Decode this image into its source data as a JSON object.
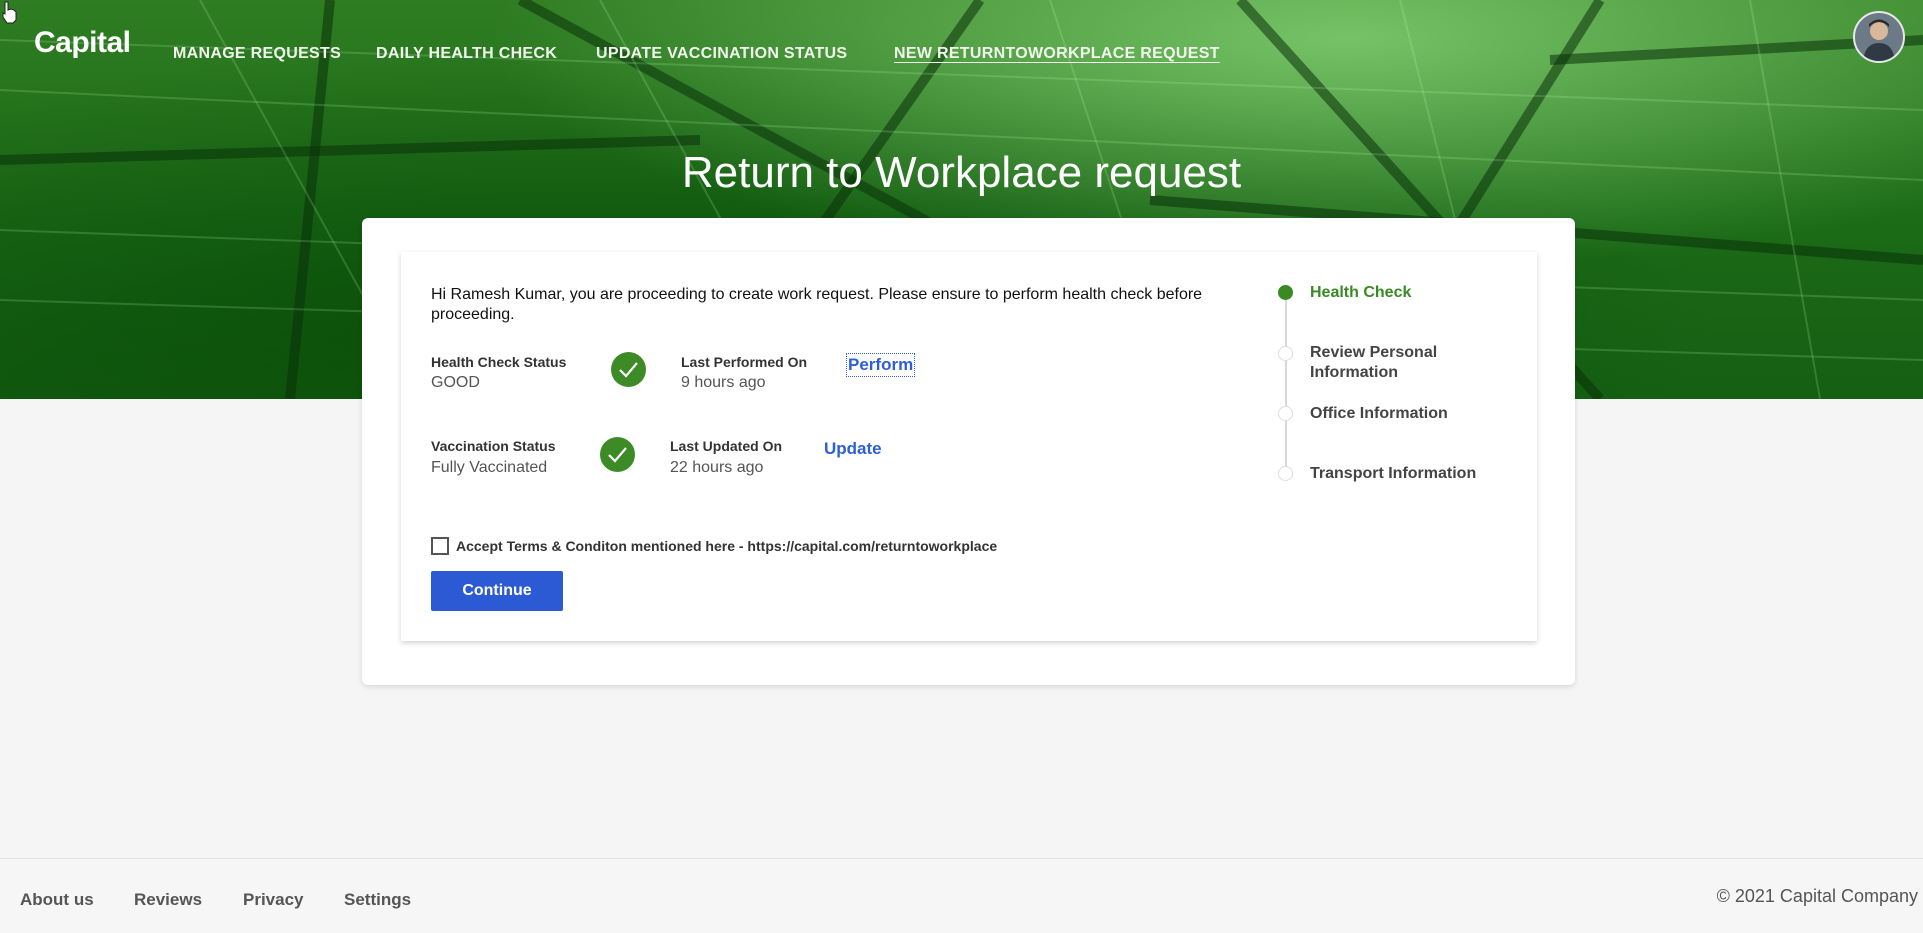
{
  "header": {
    "logo": "Capital",
    "nav": [
      {
        "label": "MANAGE REQUESTS"
      },
      {
        "label": "DAILY HEALTH CHECK"
      },
      {
        "label": "UPDATE VACCINATION STATUS"
      },
      {
        "label": "NEW RETURNTOWORKPLACE REQUEST",
        "active": true
      }
    ],
    "avatar_icon": "user-avatar"
  },
  "page": {
    "title": "Return to Workplace request"
  },
  "form": {
    "intro": "Hi Ramesh Kumar, you are proceeding to create work request. Please ensure to perform health check before proceeding.",
    "health": {
      "status_label": "Health Check Status",
      "status_value": "GOOD",
      "date_label": "Last Performed On",
      "date_value": "9 hours ago",
      "action": "Perform"
    },
    "vaccination": {
      "status_label": "Vaccination Status",
      "status_value": "Fully Vaccinated",
      "date_label": "Last Updated On",
      "date_value": "22 hours ago",
      "action": "Update"
    },
    "terms_text": "Accept Terms & Conditon mentioned here - https://capital.com/returntoworkplace",
    "terms_checked": false,
    "continue_label": "Continue"
  },
  "steps": [
    {
      "label": "Health Check",
      "active": true
    },
    {
      "label": "Review Personal Information",
      "active": false
    },
    {
      "label": "Office Information",
      "active": false
    },
    {
      "label": "Transport Information",
      "active": false
    }
  ],
  "colors": {
    "primary": "#2c5ad4",
    "success": "#3d8b26",
    "hero_green": "#1b6b17"
  },
  "footer": {
    "links": [
      "About us",
      "Reviews",
      "Privacy",
      "Settings"
    ],
    "copyright": "© 2021 Capital Company"
  }
}
